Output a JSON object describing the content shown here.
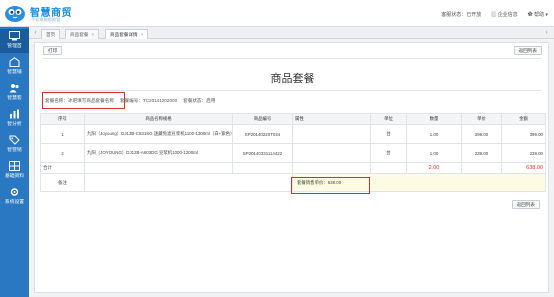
{
  "header": {
    "brand": "智慧商贸",
    "brand_sub": "手机电脑都能管",
    "customer_status": "客服状态：已开放",
    "enterprise": "企业信息",
    "help": "帮助"
  },
  "sidebar": {
    "items": [
      {
        "label": "管理首",
        "icon": "dashboard-icon"
      },
      {
        "label": "智慧铺",
        "icon": "store-icon"
      },
      {
        "label": "智慧客",
        "icon": "users-icon"
      },
      {
        "label": "智分析",
        "icon": "bar-chart-icon"
      },
      {
        "label": "智营销",
        "icon": "tag-icon"
      },
      {
        "label": "基础资料",
        "icon": "grid-icon"
      },
      {
        "label": "系统设置",
        "icon": "gear-icon"
      }
    ]
  },
  "tabs": [
    {
      "label": "首页"
    },
    {
      "label": "商品套餐"
    },
    {
      "label": "商品套餐详情"
    }
  ],
  "toolbar": {
    "print": "打印",
    "back_top": "返回列表"
  },
  "page_title": "商品套餐",
  "meta": {
    "name": "套餐名称：冰吧填写商品套餐名称",
    "code": "套餐编号：TC20141202000",
    "status": "套餐状态：启用"
  },
  "table": {
    "headers": [
      "序号",
      "商品名称规格",
      "商品编号",
      "属性",
      "单位",
      "数量",
      "单价",
      "金额"
    ],
    "rows": [
      {
        "idx": "1",
        "name": "九阳（Joyoung）DJ13B-C631SG 迷藏免滤豆浆机1100-1300ml（白+紫色）",
        "code": "SP20140220T024",
        "attr": "",
        "unit": "台",
        "qty": "1.00",
        "price": "399.00",
        "amount": "399.00"
      },
      {
        "idx": "2",
        "name": "九阳（JOYOUNG）DJ12B-A603DG 豆浆机1000-1200ml",
        "code": "SP20140331114422",
        "attr": "",
        "unit": "台",
        "qty": "1.00",
        "price": "239.00",
        "amount": "239.00"
      }
    ],
    "sum_label": "合计",
    "sum_qty": "2.00",
    "sum_amount": "638.00",
    "note_label": "备注",
    "note_price": "套餐销售单价：638.00"
  },
  "footer": {
    "back": "返回列表"
  },
  "colors": {
    "brand": "#1f8fe0",
    "sidebar": "#2b78c2",
    "highlight": "#d0342c"
  }
}
